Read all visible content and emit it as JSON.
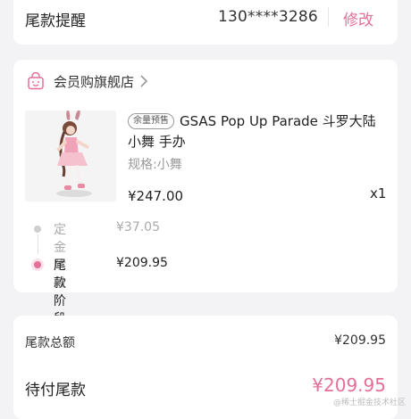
{
  "reminder": {
    "label": "尾款提醒",
    "phone": "130****3286",
    "edit_label": "修改"
  },
  "store": {
    "name": "会员购旗舰店",
    "icon": "shopping-bag-icon"
  },
  "product": {
    "tag": "余量预售",
    "title": "GSAS Pop Up Parade 斗罗大陆 小舞 手办",
    "spec": "规格:小舞",
    "price": "¥247.00",
    "quantity": "x1"
  },
  "stages": [
    {
      "name": "定金阶段",
      "amount": "¥37.05",
      "active": false
    },
    {
      "name": "尾款阶段",
      "amount": "¥209.95",
      "active": true
    }
  ],
  "summary": {
    "total_label": "尾款总额",
    "total_value": "¥209.95",
    "due_label": "待付尾款",
    "due_value": "¥209.95"
  },
  "watermark": "@稀土掘金技术社区",
  "colors": {
    "accent": "#e46f97",
    "background": "#f3f3f5"
  }
}
